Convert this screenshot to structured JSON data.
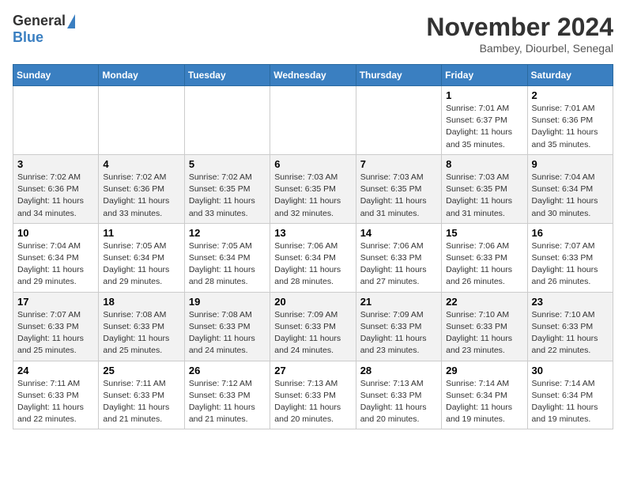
{
  "header": {
    "logo_general": "General",
    "logo_blue": "Blue",
    "month_title": "November 2024",
    "location": "Bambey, Diourbel, Senegal"
  },
  "days_of_week": [
    "Sunday",
    "Monday",
    "Tuesday",
    "Wednesday",
    "Thursday",
    "Friday",
    "Saturday"
  ],
  "weeks": [
    [
      {
        "day": "",
        "info": ""
      },
      {
        "day": "",
        "info": ""
      },
      {
        "day": "",
        "info": ""
      },
      {
        "day": "",
        "info": ""
      },
      {
        "day": "",
        "info": ""
      },
      {
        "day": "1",
        "info": "Sunrise: 7:01 AM\nSunset: 6:37 PM\nDaylight: 11 hours and 35 minutes."
      },
      {
        "day": "2",
        "info": "Sunrise: 7:01 AM\nSunset: 6:36 PM\nDaylight: 11 hours and 35 minutes."
      }
    ],
    [
      {
        "day": "3",
        "info": "Sunrise: 7:02 AM\nSunset: 6:36 PM\nDaylight: 11 hours and 34 minutes."
      },
      {
        "day": "4",
        "info": "Sunrise: 7:02 AM\nSunset: 6:36 PM\nDaylight: 11 hours and 33 minutes."
      },
      {
        "day": "5",
        "info": "Sunrise: 7:02 AM\nSunset: 6:35 PM\nDaylight: 11 hours and 33 minutes."
      },
      {
        "day": "6",
        "info": "Sunrise: 7:03 AM\nSunset: 6:35 PM\nDaylight: 11 hours and 32 minutes."
      },
      {
        "day": "7",
        "info": "Sunrise: 7:03 AM\nSunset: 6:35 PM\nDaylight: 11 hours and 31 minutes."
      },
      {
        "day": "8",
        "info": "Sunrise: 7:03 AM\nSunset: 6:35 PM\nDaylight: 11 hours and 31 minutes."
      },
      {
        "day": "9",
        "info": "Sunrise: 7:04 AM\nSunset: 6:34 PM\nDaylight: 11 hours and 30 minutes."
      }
    ],
    [
      {
        "day": "10",
        "info": "Sunrise: 7:04 AM\nSunset: 6:34 PM\nDaylight: 11 hours and 29 minutes."
      },
      {
        "day": "11",
        "info": "Sunrise: 7:05 AM\nSunset: 6:34 PM\nDaylight: 11 hours and 29 minutes."
      },
      {
        "day": "12",
        "info": "Sunrise: 7:05 AM\nSunset: 6:34 PM\nDaylight: 11 hours and 28 minutes."
      },
      {
        "day": "13",
        "info": "Sunrise: 7:06 AM\nSunset: 6:34 PM\nDaylight: 11 hours and 28 minutes."
      },
      {
        "day": "14",
        "info": "Sunrise: 7:06 AM\nSunset: 6:33 PM\nDaylight: 11 hours and 27 minutes."
      },
      {
        "day": "15",
        "info": "Sunrise: 7:06 AM\nSunset: 6:33 PM\nDaylight: 11 hours and 26 minutes."
      },
      {
        "day": "16",
        "info": "Sunrise: 7:07 AM\nSunset: 6:33 PM\nDaylight: 11 hours and 26 minutes."
      }
    ],
    [
      {
        "day": "17",
        "info": "Sunrise: 7:07 AM\nSunset: 6:33 PM\nDaylight: 11 hours and 25 minutes."
      },
      {
        "day": "18",
        "info": "Sunrise: 7:08 AM\nSunset: 6:33 PM\nDaylight: 11 hours and 25 minutes."
      },
      {
        "day": "19",
        "info": "Sunrise: 7:08 AM\nSunset: 6:33 PM\nDaylight: 11 hours and 24 minutes."
      },
      {
        "day": "20",
        "info": "Sunrise: 7:09 AM\nSunset: 6:33 PM\nDaylight: 11 hours and 24 minutes."
      },
      {
        "day": "21",
        "info": "Sunrise: 7:09 AM\nSunset: 6:33 PM\nDaylight: 11 hours and 23 minutes."
      },
      {
        "day": "22",
        "info": "Sunrise: 7:10 AM\nSunset: 6:33 PM\nDaylight: 11 hours and 23 minutes."
      },
      {
        "day": "23",
        "info": "Sunrise: 7:10 AM\nSunset: 6:33 PM\nDaylight: 11 hours and 22 minutes."
      }
    ],
    [
      {
        "day": "24",
        "info": "Sunrise: 7:11 AM\nSunset: 6:33 PM\nDaylight: 11 hours and 22 minutes."
      },
      {
        "day": "25",
        "info": "Sunrise: 7:11 AM\nSunset: 6:33 PM\nDaylight: 11 hours and 21 minutes."
      },
      {
        "day": "26",
        "info": "Sunrise: 7:12 AM\nSunset: 6:33 PM\nDaylight: 11 hours and 21 minutes."
      },
      {
        "day": "27",
        "info": "Sunrise: 7:13 AM\nSunset: 6:33 PM\nDaylight: 11 hours and 20 minutes."
      },
      {
        "day": "28",
        "info": "Sunrise: 7:13 AM\nSunset: 6:33 PM\nDaylight: 11 hours and 20 minutes."
      },
      {
        "day": "29",
        "info": "Sunrise: 7:14 AM\nSunset: 6:34 PM\nDaylight: 11 hours and 19 minutes."
      },
      {
        "day": "30",
        "info": "Sunrise: 7:14 AM\nSunset: 6:34 PM\nDaylight: 11 hours and 19 minutes."
      }
    ]
  ]
}
